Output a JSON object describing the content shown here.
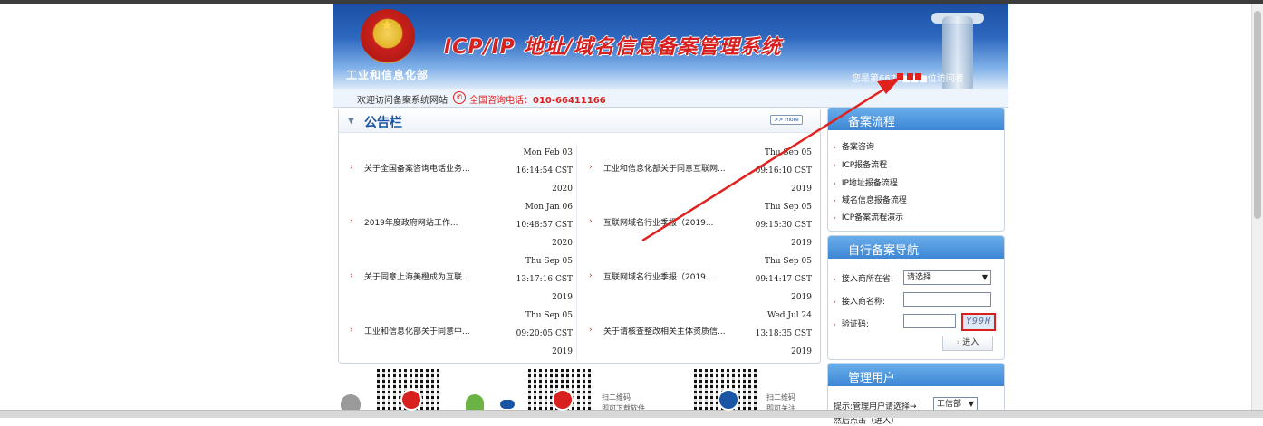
{
  "header": {
    "ministry": "工业和信息化部",
    "system_title": "ICP/IP 地址/域名信息备案管理系统",
    "visitor_text": "您是第6679■■■位访问者"
  },
  "infobar": {
    "welcome": "欢迎访问备案系统网站",
    "phone_label": "全国咨询电话：",
    "phone_number": "010-66411166"
  },
  "notice": {
    "title": "公告栏",
    "more": ">> more",
    "items": [
      {
        "title": "关于全国备案咨询电话业务...",
        "d1": "Mon Feb 03",
        "d2": "16:14:54 CST",
        "d3": "2020"
      },
      {
        "title": "工业和信息化部关于同意互联网...",
        "d1": "Thu Sep 05",
        "d2": "09:16:10 CST",
        "d3": "2019"
      },
      {
        "title": "2019年度政府网站工作...",
        "d1": "Mon Jan 06",
        "d2": "10:48:57 CST",
        "d3": "2020"
      },
      {
        "title": "互联网域名行业季报（2019...",
        "d1": "Thu Sep 05",
        "d2": "09:15:30 CST",
        "d3": "2019"
      },
      {
        "title": "关于同意上海美橙成为互联...",
        "d1": "Thu Sep 05",
        "d2": "13:17:16 CST",
        "d3": "2019"
      },
      {
        "title": "互联网域名行业季报（2019...",
        "d1": "Thu Sep 05",
        "d2": "09:14:17 CST",
        "d3": "2019"
      },
      {
        "title": "工业和信息化部关于同意中...",
        "d1": "Thu Sep 05",
        "d2": "09:20:05 CST",
        "d3": "2019"
      },
      {
        "title": "关于请核查整改相关主体资质信...",
        "d1": "Wed Jul 24",
        "d2": "13:18:35 CST",
        "d3": "2019"
      }
    ]
  },
  "process": {
    "title": "备案流程",
    "links": [
      "备案咨询",
      "ICP报备流程",
      "IP地址报备流程",
      "域名信息报备流程",
      "ICP备案流程演示"
    ]
  },
  "selfnav": {
    "title": "自行备案导航",
    "province_label": "接入商所在省:",
    "province_value": "请选择",
    "name_label": "接入商名称:",
    "captcha_label": "验证码:",
    "captcha_text": "Y99H",
    "enter_label": "进入"
  },
  "admin": {
    "title": "管理用户",
    "hint": "提示:管理用户请选择→",
    "dept_value": "工信部",
    "more_line": "然后点击（进入）"
  },
  "downloads": {
    "qr1_text1": "扫二维码",
    "qr1_text2": "即可下载软件",
    "qr2_text1": "扫二维码",
    "qr2_text2": "即可关注"
  },
  "colors": {
    "accent_red": "#d8201f",
    "header_blue": "#1b4fa3",
    "panel_blue": "#3d86d5"
  },
  "icons": [
    "emblem-icon",
    "phone-icon",
    "arrow-bullet-icon",
    "apple-icon",
    "android-icon",
    "cloud-icon",
    "qr-code-icon",
    "annotation-arrow-icon"
  ]
}
